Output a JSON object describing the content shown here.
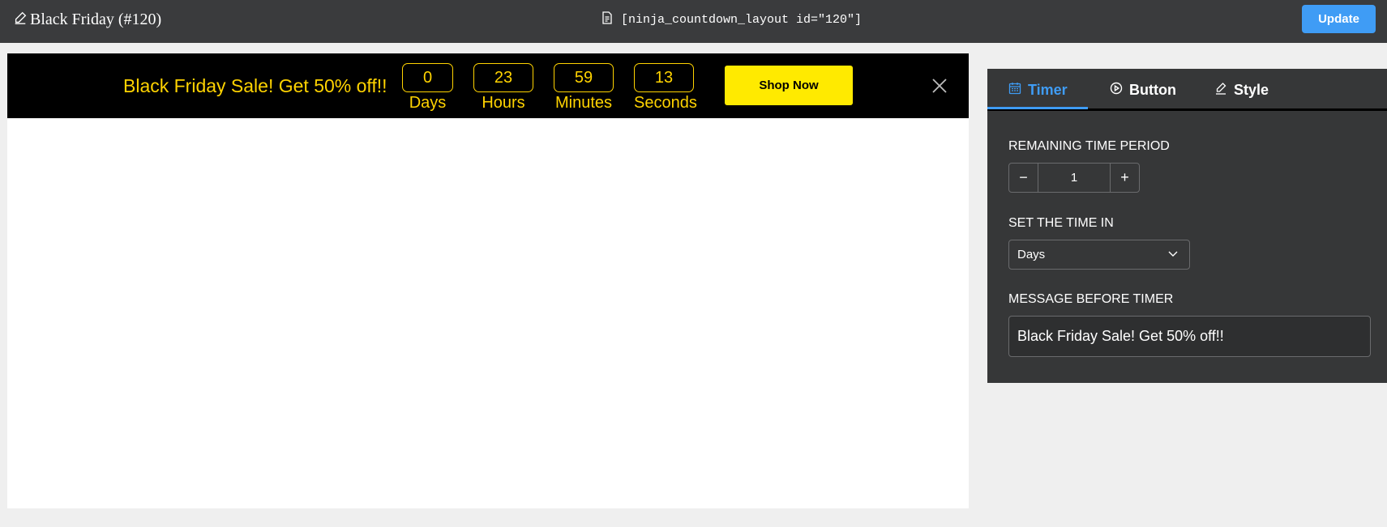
{
  "header": {
    "title": "Black Friday (#120)",
    "title_icon": "pencil-icon",
    "shortcode": "[ninja_countdown_layout id=\"120\"]",
    "shortcode_icon": "document-icon",
    "update_label": "Update"
  },
  "banner": {
    "message": "Black Friday Sale! Get 50% off!!",
    "countdown": [
      {
        "value": "0",
        "label": "Days"
      },
      {
        "value": "23",
        "label": "Hours"
      },
      {
        "value": "59",
        "label": "Minutes"
      },
      {
        "value": "13",
        "label": "Seconds"
      }
    ],
    "button_label": "Shop Now",
    "close_icon": "close-icon"
  },
  "panel": {
    "tabs": [
      {
        "label": "Timer",
        "icon": "calendar-icon",
        "active": true
      },
      {
        "label": "Button",
        "icon": "play-circle-icon",
        "active": false
      },
      {
        "label": "Style",
        "icon": "pencil-icon",
        "active": false
      }
    ],
    "remaining_label": "REMAINING TIME PERIOD",
    "remaining_value": "1",
    "time_in_label": "SET THE TIME IN",
    "time_in_value": "Days",
    "message_label": "MESSAGE BEFORE TIMER",
    "message_value": "Black Friday Sale! Get 50% off!!"
  },
  "colors": {
    "topbar_bg": "#3a3b3d",
    "accent": "#3f9cf5",
    "banner_bg": "#000000",
    "banner_text": "#ffd300",
    "shop_button": "#ffea00",
    "panel_bg": "#363738"
  }
}
